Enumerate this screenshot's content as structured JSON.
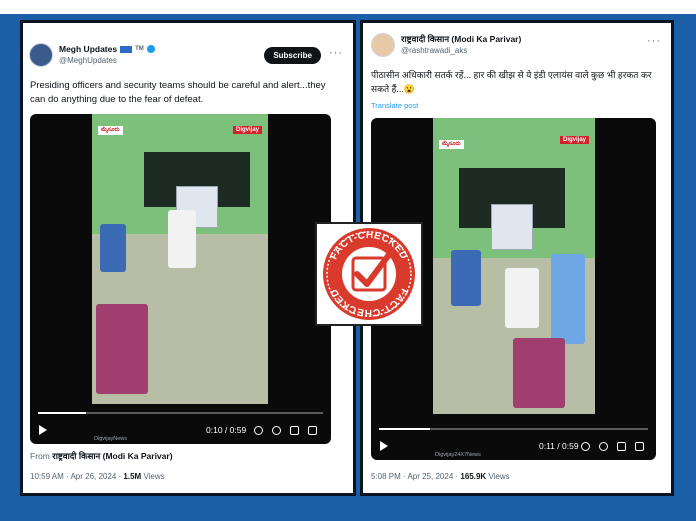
{
  "left_post": {
    "author": "Megh Updates",
    "author_badges": "TM",
    "handle": "@MeghUpdates",
    "subscribe_label": "Subscribe",
    "text": "Presiding officers and security teams should be careful and alert...they can do anything due to the fear of defeat.",
    "video": {
      "time": "0:10 / 0:59",
      "progress": 0.17,
      "location_tag": "ಮೈಸೂರು",
      "channel_tag": "Digvijay",
      "watermark": "DigvijayNews"
    },
    "from_label": "From",
    "from_source": "राष्ट्रवादी किसान (Modi Ka Parivar)",
    "timestamp": "10:59 AM · Apr 26, 2024 ·",
    "views_count": "1.5M",
    "views_label": "Views"
  },
  "right_post": {
    "author": "राष्ट्रवादी किसान (Modi Ka Parivar)",
    "handle": "@rashtrawadi_aks",
    "text": "पीठासीन अधिकारी सतर्क रहें... हार की खीझ से ये इंडी एलायंस वाले कुछ भी हरकत कर सकते हैं...😮",
    "translate_label": "Translate post",
    "video": {
      "time": "0:11 / 0:59",
      "progress": 0.19,
      "location_tag": "ಮೈಸೂರು",
      "channel_tag": "Digvijay",
      "watermark": "Digvijay24X7News"
    },
    "timestamp": "5:08 PM · Apr 25, 2024 ·",
    "views_count": "165.9K",
    "views_label": "Views"
  },
  "stamp": {
    "top_text": "FACT-CHECKED",
    "bottom_text": "FACT-CHECKED",
    "color": "#d93a2b"
  },
  "colors": {
    "background": "#1a5fa8",
    "link": "#1d9bf0"
  }
}
